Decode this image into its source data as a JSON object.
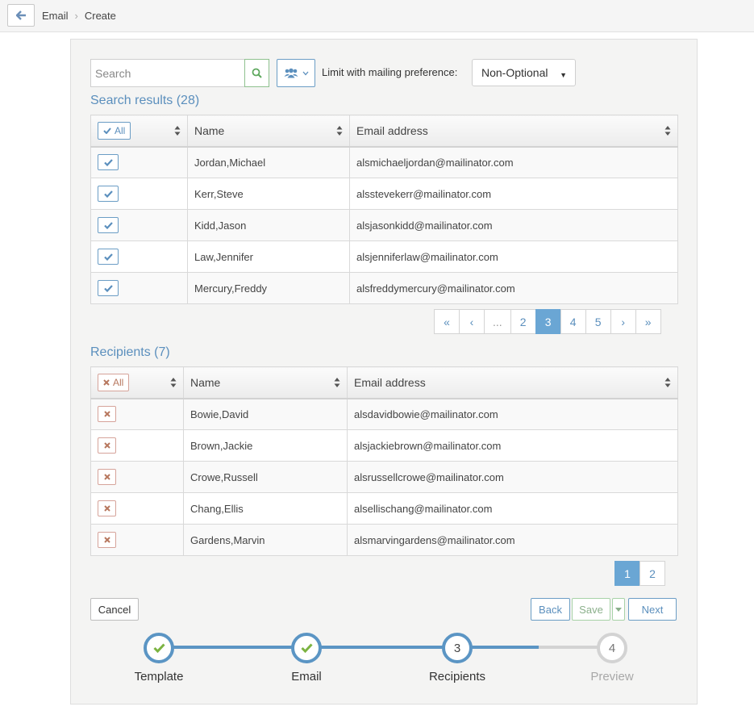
{
  "breadcrumb": {
    "items": [
      "Email",
      "Create"
    ]
  },
  "search": {
    "placeholder": "Search"
  },
  "filter": {
    "limit_label": "Limit with mailing preference:",
    "selected": "Non-Optional"
  },
  "search_results": {
    "title": "Search results (28)",
    "all_label": "All",
    "columns": [
      "Name",
      "Email address"
    ],
    "rows": [
      {
        "name": "Jordan,Michael",
        "email": "alsmichaeljordan@mailinator.com"
      },
      {
        "name": "Kerr,Steve",
        "email": "alssteve kerr@mailinator.com"
      },
      {
        "name": "Kidd,Jason",
        "email": "alsjasonkidd@mailinator.com"
      },
      {
        "name": "Law,Jennifer",
        "email": "alsjenniferlaw@mailinator.com"
      },
      {
        "name": "Mercury,Freddy",
        "email": "alsfreddymercury@mailinator.com"
      }
    ],
    "pager": [
      "«",
      "‹",
      "...",
      "2",
      "3",
      "4",
      "5",
      "›",
      "»"
    ],
    "active_page": "3"
  },
  "recipients": {
    "title": "Recipients (7)",
    "all_label": "All",
    "columns": [
      "Name",
      "Email address"
    ],
    "rows": [
      {
        "name": "Bowie,David",
        "email": "alsdavidbowie@mailinator.com"
      },
      {
        "name": "Brown,Jackie",
        "email": "alsjackiebrown@mailinator.com"
      },
      {
        "name": "Crowe,Russell",
        "email": "alsrussellcrowe@mailinator.com"
      },
      {
        "name": "Chang,Ellis",
        "email": "alsellischang@mailinator.com"
      },
      {
        "name": "Gardens,Marvin",
        "email": "alsmarvingardens@mailinator.com"
      }
    ],
    "pager": [
      "1",
      "2"
    ],
    "active_page": "1"
  },
  "actions": {
    "cancel": "Cancel",
    "back": "Back",
    "save": "Save",
    "next": "Next"
  },
  "steps": [
    {
      "number": "1",
      "label": "Template",
      "state": "done"
    },
    {
      "number": "2",
      "label": "Email",
      "state": "done"
    },
    {
      "number": "3",
      "label": "Recipients",
      "state": "current"
    },
    {
      "number": "4",
      "label": "Preview",
      "state": "todo"
    }
  ],
  "colors": {
    "accent": "#5b8fbd",
    "step_blue": "#5b95c4",
    "check_green": "#7cb342",
    "remove_red": "#b7775e",
    "inactive": "#d3d3d3"
  }
}
